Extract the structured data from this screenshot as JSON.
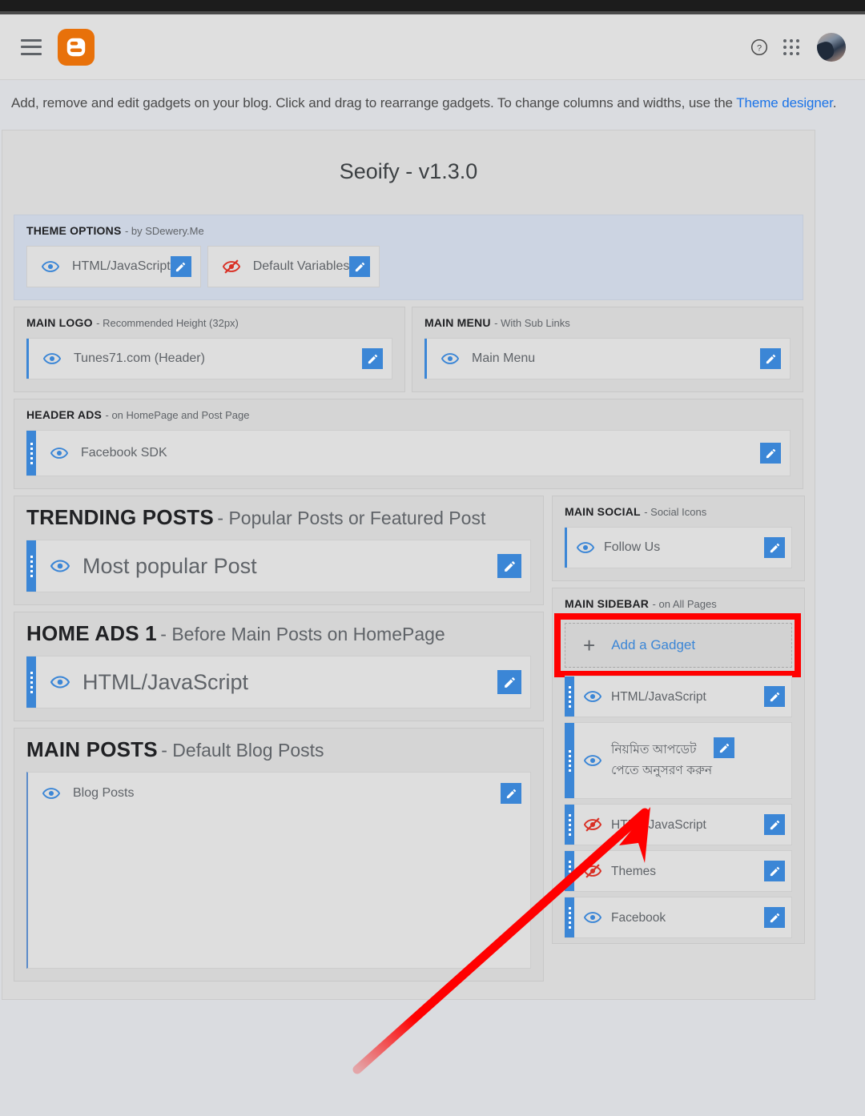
{
  "topbar": {
    "menu_icon": "hamburger-icon",
    "logo_icon": "blogger-logo-icon",
    "help_icon": "help-icon",
    "apps_icon": "apps-grid-icon",
    "avatar_icon": "user-avatar"
  },
  "description": {
    "text_before": "Add, remove and edit gadgets on your blog. Click and drag to rearrange gadgets. To change columns and widths, use the ",
    "link_text": "Theme designer",
    "text_after": "."
  },
  "theme": {
    "title": "Seoify - v1.3.0"
  },
  "sections": {
    "theme_options": {
      "name": "THEME OPTIONS",
      "sub": "- by SDewery.Me",
      "gadgets": [
        {
          "label": "HTML/JavaScript",
          "visible": true
        },
        {
          "label": "Default Variables",
          "visible": false
        }
      ]
    },
    "main_logo": {
      "name": "MAIN LOGO",
      "sub": "- Recommended Height (32px)",
      "gadgets": [
        {
          "label": "Tunes71.com (Header)",
          "visible": true
        }
      ]
    },
    "main_menu": {
      "name": "MAIN MENU",
      "sub": "- With Sub Links",
      "gadgets": [
        {
          "label": "Main Menu",
          "visible": true
        }
      ]
    },
    "header_ads": {
      "name": "HEADER ADS",
      "sub": "- on HomePage and Post Page",
      "gadgets": [
        {
          "label": "Facebook SDK",
          "visible": true
        }
      ]
    },
    "trending_posts": {
      "name": "TRENDING POSTS",
      "sub": "- Popular Posts or Featured Post",
      "gadgets": [
        {
          "label": "Most popular Post",
          "visible": true
        }
      ]
    },
    "home_ads_1": {
      "name": "HOME ADS 1",
      "sub": "- Before Main Posts on HomePage",
      "gadgets": [
        {
          "label": "HTML/JavaScript",
          "visible": true
        }
      ]
    },
    "main_posts": {
      "name": "MAIN POSTS",
      "sub": "- Default Blog Posts",
      "gadgets": [
        {
          "label": "Blog Posts",
          "visible": true
        }
      ]
    },
    "main_social": {
      "name": "MAIN SOCIAL",
      "sub": "- Social Icons",
      "gadgets": [
        {
          "label": "Follow Us",
          "visible": true
        }
      ]
    },
    "main_sidebar": {
      "name": "MAIN SIDEBAR",
      "sub": "- on All Pages",
      "add_gadget_label": "Add a Gadget",
      "add_gadget_plus": "+",
      "gadgets": [
        {
          "label": "HTML/JavaScript",
          "visible": true
        },
        {
          "label": "নিয়মিত আপডেট পেতে অনুসরণ করুন",
          "visible": true
        },
        {
          "label": "HTML/JavaScript",
          "visible": false
        },
        {
          "label": "Themes",
          "visible": false
        },
        {
          "label": "Facebook",
          "visible": true
        }
      ]
    }
  },
  "colors": {
    "accent_blue": "#3b86d6",
    "link_blue": "#1a73e8",
    "hidden_red": "#d93025",
    "highlight_red": "#ff0000",
    "blogger_orange": "#e8710a",
    "page_bg": "#dadce0"
  }
}
